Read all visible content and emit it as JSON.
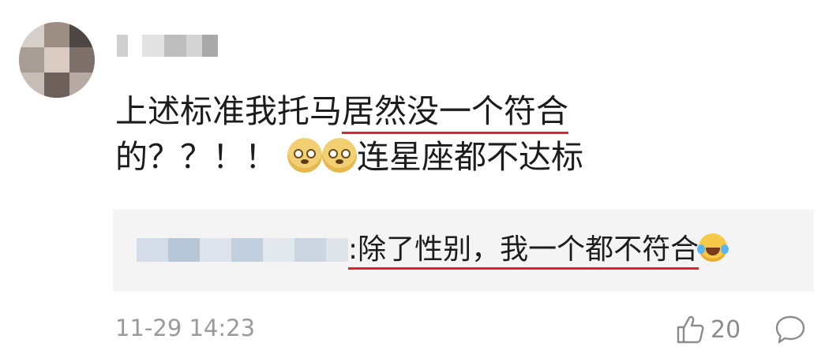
{
  "comment": {
    "text_line1_plain": "上述标准我托马",
    "text_line1_underlined": "居然没一个符合",
    "text_line2_a": "的？？！！",
    "emoji_names": [
      "doge-emoji",
      "doge-emoji"
    ],
    "text_line2_b": "连星座都不达标"
  },
  "reply": {
    "text": ":除了性别，我一个都不符合",
    "emoji": "laughing-tears-emoji"
  },
  "meta": {
    "timestamp": "11-29 14:23",
    "like_count": "20",
    "like_icon": "thumbs-up-icon",
    "comment_icon": "speech-bubble-icon"
  },
  "colors": {
    "underline": "#e0222f",
    "reply_bg": "#f4f4f4",
    "meta_text": "#9a9a9a"
  }
}
